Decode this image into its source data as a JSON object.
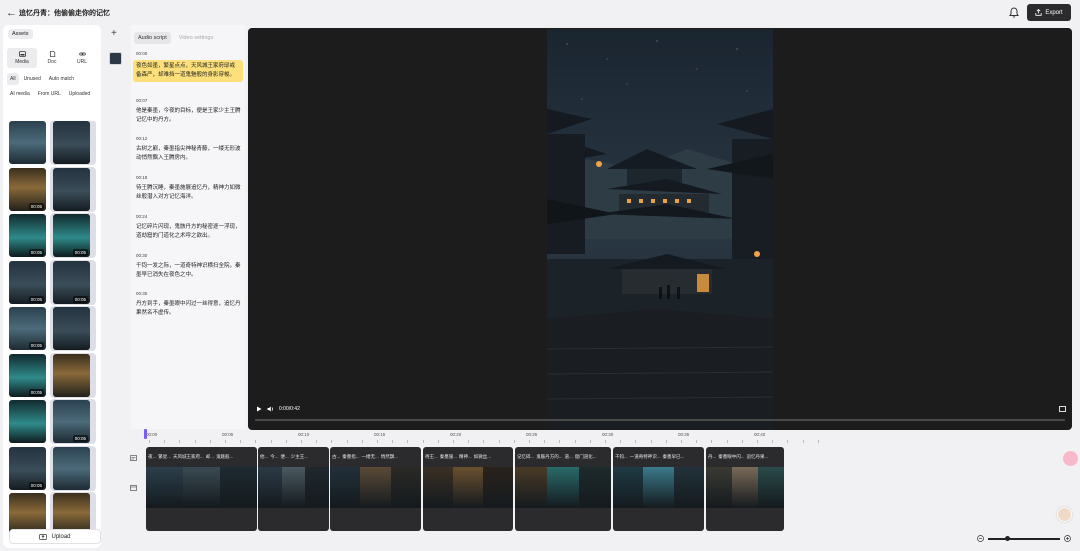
{
  "header": {
    "title": "追忆丹青：他偷偷走你的记忆",
    "export_label": "Export"
  },
  "assets_panel": {
    "tab_label": "Assets",
    "source_tabs": [
      "Media",
      "Doc",
      "URL"
    ],
    "filters": [
      "All",
      "Unused",
      "Auto match",
      "AI media",
      "From URL",
      "Uploaded"
    ],
    "thumbs": [
      {
        "dur": "",
        "kind": "portrait"
      },
      {
        "dur": "",
        "kind": "scene"
      },
      {
        "dur": "00:05",
        "kind": "lamp"
      },
      {
        "dur": "",
        "kind": "scene"
      },
      {
        "dur": "00:05",
        "kind": "glow"
      },
      {
        "dur": "00:05",
        "kind": "glow"
      },
      {
        "dur": "00:05",
        "kind": "scene"
      },
      {
        "dur": "00:05",
        "kind": "scene"
      },
      {
        "dur": "00:05",
        "kind": "portrait"
      },
      {
        "dur": "",
        "kind": "scene"
      },
      {
        "dur": "00:05",
        "kind": "glow"
      },
      {
        "dur": "",
        "kind": "lamp"
      },
      {
        "dur": "",
        "kind": "glow"
      },
      {
        "dur": "00:05",
        "kind": "portrait"
      },
      {
        "dur": "00:05",
        "kind": "scene"
      },
      {
        "dur": "",
        "kind": "portrait"
      },
      {
        "dur": "",
        "kind": "lamp"
      },
      {
        "dur": "",
        "kind": "lamp"
      }
    ],
    "upload_label": "Upload"
  },
  "script_panel": {
    "tabs": [
      "Audio script",
      "Video settings"
    ],
    "segments": [
      {
        "time": "00:00",
        "text": "夜色如墨，繁星点点，天风城王家府邸戒备森严，却难挡一道鬼魅般的身影穿梭。"
      },
      {
        "time": "00:07",
        "text": "他是秦墨，今夜的目标，便是王家少主王腾记忆中的丹方。"
      },
      {
        "time": "00:12",
        "text": "古树之巅，秦墨指尖神秘青藤，一缕无形波动悄然飘入王腾房内。"
      },
      {
        "time": "00:18",
        "text": "待王腾沉睡，秦墨施展追忆丹，精神力如微丝般潜入对方记忆海洋。"
      },
      {
        "time": "00:24",
        "text": "记忆碎片闪现，鬼骸丹方的秘密逐一浮现，道劫窟的门道化之术呼之欲出。"
      },
      {
        "time": "00:30",
        "text": "千钧一发之际，一道奇特神识横扫全院，秦墨早已消失在夜色之中。"
      },
      {
        "time": "00:35",
        "text": "丹方到手，秦墨眼中闪过一丝得意，追忆丹果然名不虚传。"
      }
    ]
  },
  "player": {
    "time": "0:00/0:42",
    "progress": 0
  },
  "timeline": {
    "ruler": [
      "00:00",
      "00:05",
      "00:10",
      "00:15",
      "00:20",
      "00:25",
      "00:30",
      "00:35",
      "00:40"
    ],
    "clips": [
      {
        "captions": [
          "夜...",
          "繁星...",
          "天风城王家府...",
          "却...",
          "鬼魅般..."
        ]
      },
      {
        "captions": [
          "他...",
          "今...",
          "便...",
          "少主王..."
        ]
      },
      {
        "captions": [
          "古...",
          "秦墨指...",
          "一缕无...",
          "悄然飘..."
        ]
      },
      {
        "captions": [
          "待王...",
          "秦墨施...",
          "精神...",
          "如微丝..."
        ]
      },
      {
        "captions": [
          "记忆碎...",
          "鬼骸丹方的...",
          "道...",
          "窟门道化..."
        ]
      },
      {
        "captions": [
          "千钧...",
          "一道奇特神识...",
          "秦墨早已..."
        ]
      },
      {
        "captions": [
          "丹...",
          "秦墨眼中闪...",
          "追忆丹果..."
        ]
      }
    ]
  },
  "colors": {
    "accent": "#7b5cf0",
    "highlight": "#fde07a",
    "export_bg": "#2b2b2e"
  }
}
